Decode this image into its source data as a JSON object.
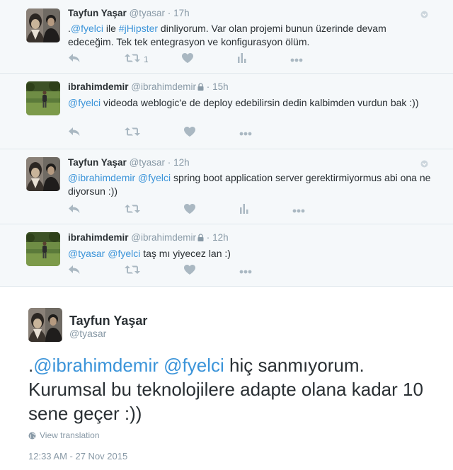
{
  "tweets": [
    {
      "name": "Tayfun Yaşar",
      "handle": "@tyasar",
      "dot": "·",
      "time": "17h",
      "text": [
        {
          "t": ".",
          "link": false
        },
        {
          "t": "@fyelci",
          "link": true
        },
        {
          "t": " ile ",
          "link": false
        },
        {
          "t": "#jHipster",
          "link": true
        },
        {
          "t": " dinliyorum. Var olan projemi bunun üzerinde devam edeceğim. Tek tek entegrasyon ve konfigurasyon ölüm.",
          "link": false
        }
      ],
      "retweet_count": "1"
    },
    {
      "name": "ibrahimdemir",
      "handle": "@ibrahimdemir",
      "dot": "·",
      "time": "15h",
      "text": [
        {
          "t": "@fyelci",
          "link": true
        },
        {
          "t": " videoda weblogic'e de deploy edebilirsin dedin kalbimden vurdun bak :))",
          "link": false
        }
      ]
    },
    {
      "name": "Tayfun Yaşar",
      "handle": "@tyasar",
      "dot": "·",
      "time": "12h",
      "text": [
        {
          "t": "@ibrahimdemir",
          "link": true
        },
        {
          "t": " ",
          "link": false
        },
        {
          "t": "@fyelci",
          "link": true
        },
        {
          "t": " spring boot application server gerektirmiyormus abi ona ne diyorsun :))",
          "link": false
        }
      ]
    },
    {
      "name": "ibrahimdemir",
      "handle": "@ibrahimdemir",
      "dot": "·",
      "time": "12h",
      "text": [
        {
          "t": "@tyasar",
          "link": true
        },
        {
          "t": " ",
          "link": false
        },
        {
          "t": "@fyelci",
          "link": true
        },
        {
          "t": " taş mı yiyecez lan :)",
          "link": false
        }
      ]
    }
  ],
  "main_tweet": {
    "name": "Tayfun Yaşar",
    "handle": "@tyasar",
    "text": [
      {
        "t": ".",
        "link": false
      },
      {
        "t": "@ibrahimdemir",
        "link": true
      },
      {
        "t": " ",
        "link": false
      },
      {
        "t": "@fyelci",
        "link": true
      },
      {
        "t": " hiç sanmıyorum. Kurumsal bu teknolojilere adapte olana kadar 10 sene geçer :))",
        "link": false
      }
    ],
    "view_translation": "View translation",
    "timestamp": "12:33 AM - 27 Nov 2015"
  },
  "colors": {
    "link": "#3b94d9",
    "muted": "#8899a6",
    "icon": "#aab8c2",
    "thread_bg": "#f5f8fa"
  },
  "icons": [
    "reply-icon",
    "retweet-icon",
    "like-icon",
    "analytics-icon",
    "more-icon",
    "lock-icon",
    "globe-icon",
    "caret-icon"
  ]
}
